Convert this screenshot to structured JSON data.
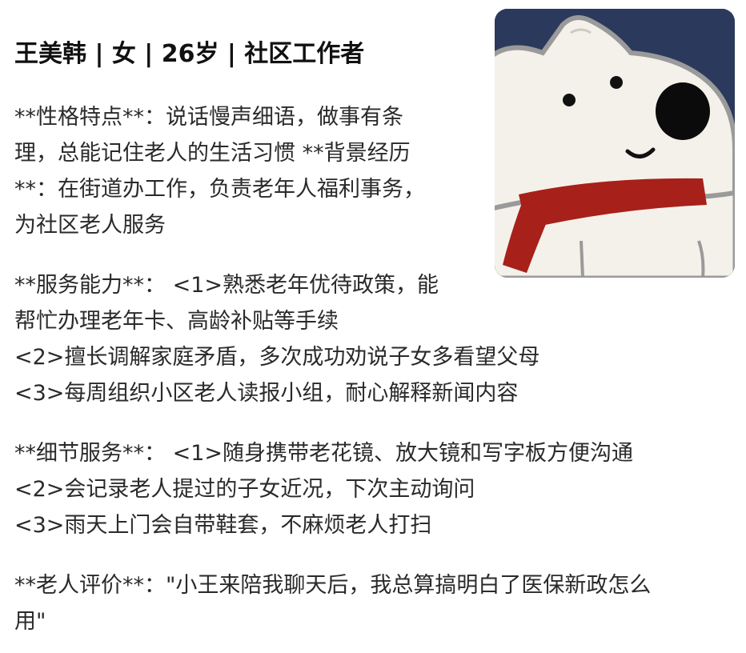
{
  "title": "王美韩 | 女 | 26岁 | 社区工作者",
  "avatar": {
    "icon": "cartoon-dog-with-red-scarf",
    "background_color": "#2b3a5c",
    "scarf_color": "#a8201a",
    "body_color": "#f4f1ea"
  },
  "sections": {
    "personality": {
      "lines": [
        "**性格特点**：说话慢声细语，做事有条",
        "理，总能记住老人的生活习惯 **背景经历",
        "**：在街道办工作，负责老年人福利事务，",
        "为社区老人服务"
      ]
    },
    "service_ability": {
      "lines": [
        "**服务能力**： <1>熟悉老年优待政策，能",
        "帮忙办理老年卡、高龄补贴等手续",
        "<2>擅长调解家庭矛盾，多次成功劝说子女多看望父母",
        "<3>每周组织小区老人读报小组，耐心解释新闻内容"
      ]
    },
    "detail_service": {
      "lines": [
        "**细节服务**： <1>随身携带老花镜、放大镜和写字板方便沟通",
        "<2>会记录老人提过的子女近况，下次主动询问",
        "<3>雨天上门会自带鞋套，不麻烦老人打扫"
      ]
    },
    "elder_review": {
      "lines": [
        "**老人评价**：\"小王来陪我聊天后，我总算搞明白了医保新政怎么",
        "用\""
      ]
    }
  }
}
